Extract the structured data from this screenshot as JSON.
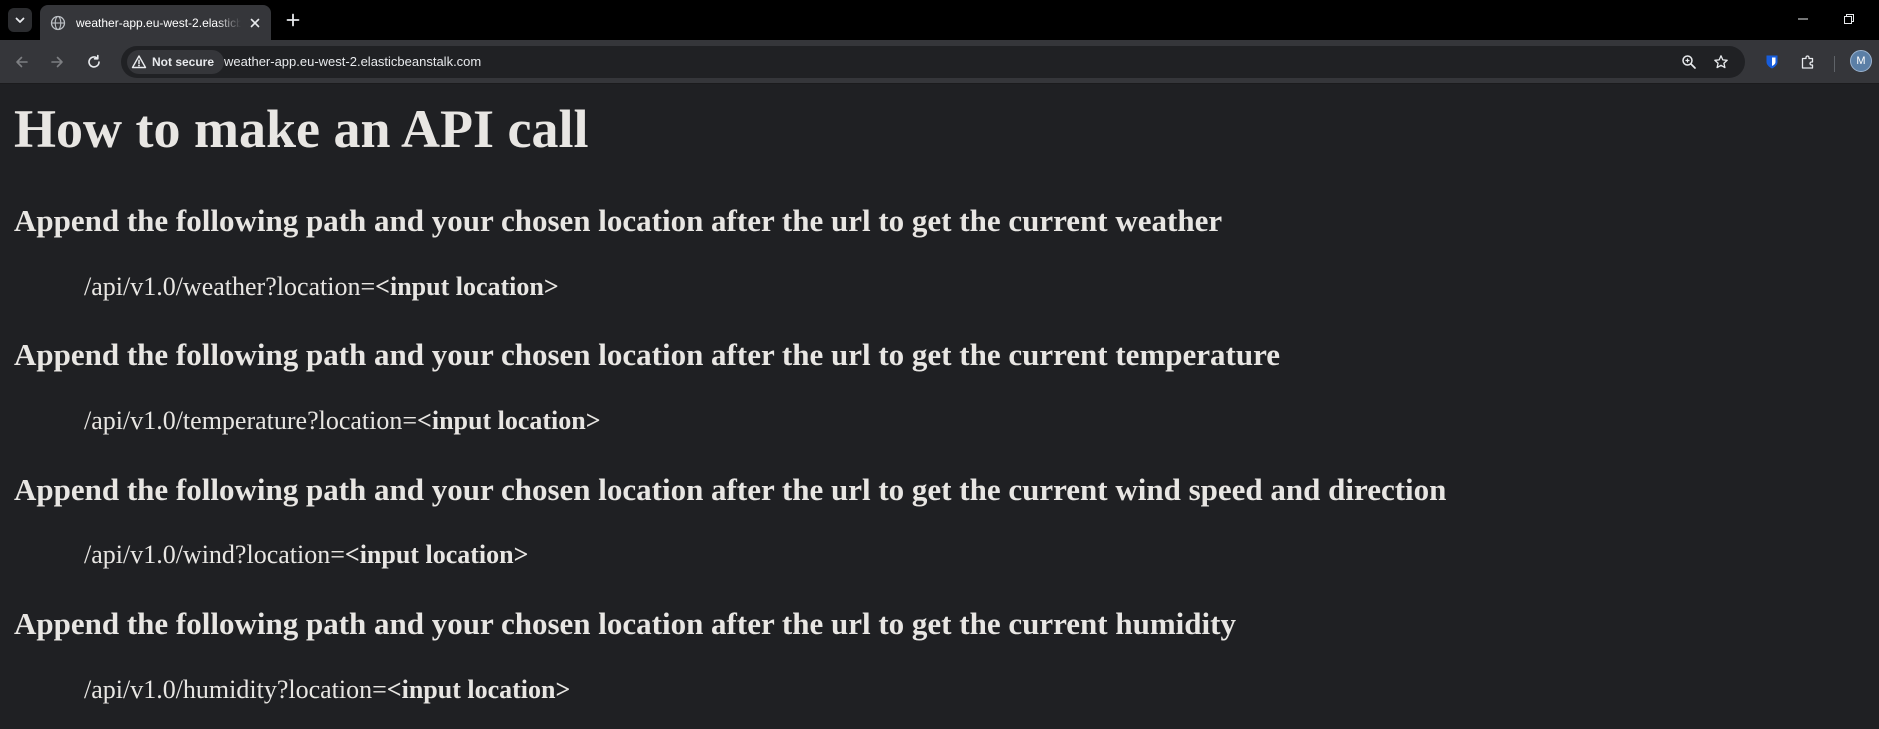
{
  "browser": {
    "tab": {
      "title": "weather-app.eu-west-2.elasticbeanstalk.com"
    },
    "omnibox": {
      "security_label": "Not secure",
      "url": "weather-app.eu-west-2.elasticbeanstalk.com"
    },
    "profile_initial": "M",
    "icons": {
      "tab_search": "chevron-down-icon",
      "favicon": "globe-icon",
      "tab_close": "close-icon",
      "new_tab": "plus-icon",
      "minimize": "minimize-icon",
      "restore": "restore-icon",
      "back": "arrow-left-icon",
      "forward": "arrow-right-icon",
      "reload": "reload-icon",
      "warning": "warning-triangle-icon",
      "zoom": "zoom-icon",
      "bookmark": "star-icon",
      "password_manager": "shield-icon",
      "extensions": "puzzle-icon"
    },
    "colors": {
      "tabstrip": "#000000",
      "toolbar": "#35363a",
      "omnibox": "#202124",
      "page_background": "#1f2023",
      "page_text": "#e8e6e3"
    }
  },
  "page": {
    "title": "How to make an API call",
    "sections": [
      {
        "heading": "Append the following path and your chosen location after the url to get the current weather",
        "path": "/api/v1.0/weather?location=",
        "placeholder": "<input location>"
      },
      {
        "heading": "Append the following path and your chosen location after the url to get the current temperature",
        "path": "/api/v1.0/temperature?location=",
        "placeholder": "<input location>"
      },
      {
        "heading": "Append the following path and your chosen location after the url to get the current wind speed and direction",
        "path": "/api/v1.0/wind?location=",
        "placeholder": "<input location>"
      },
      {
        "heading": "Append the following path and your chosen location after the url to get the current humidity",
        "path": "/api/v1.0/humidity?location=",
        "placeholder": "<input location>"
      }
    ]
  }
}
